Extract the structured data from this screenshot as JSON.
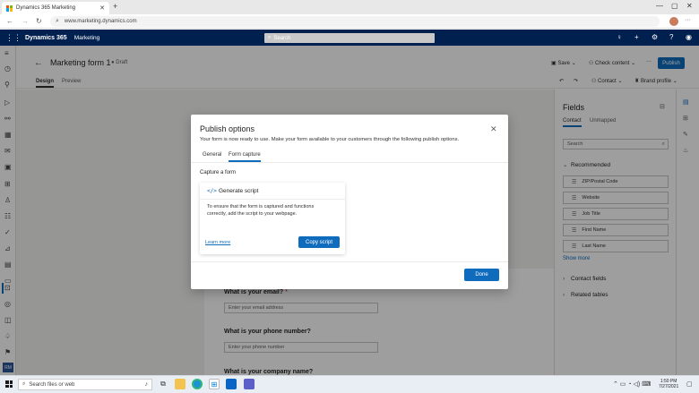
{
  "browser": {
    "tab_title": "Dynamics 365 Marketing",
    "tab_close": "✕",
    "new_tab": "+",
    "url": "www.marketing.dynamics.com",
    "window_controls": [
      "—",
      "▢",
      "✕"
    ],
    "more": "···"
  },
  "appbar": {
    "product": "Dynamics 365",
    "module": "Marketing",
    "search_placeholder": "Search",
    "icons": [
      "lightbulb-icon",
      "plus-icon",
      "gear-icon",
      "help-icon",
      "user-icon"
    ]
  },
  "header": {
    "form_title": "Marketing form 1",
    "status": "Draft",
    "save_label": "Save",
    "check_content_label": "Check content",
    "more_label": "···",
    "publish_label": "Publish",
    "contact_label": "Contact",
    "brand_profile_label": "Brand profile",
    "tabs": [
      {
        "label": "Design"
      },
      {
        "label": "Preview"
      }
    ]
  },
  "form": {
    "questions": [
      {
        "label": "What is your email?",
        "required": "*",
        "placeholder": "Enter your email address"
      },
      {
        "label": "What is your phone number?",
        "required": "",
        "placeholder": "Enter your phone number"
      },
      {
        "label": "What is your company name?",
        "required": "",
        "placeholder": ""
      }
    ]
  },
  "fields_pane": {
    "title": "Fields",
    "tabs": [
      "Contact",
      "Unmapped"
    ],
    "search_placeholder": "Search",
    "recommended_label": "Recommended",
    "items": [
      "ZIP/Postal Code",
      "Website",
      "Job Title",
      "First Name",
      "Last Name"
    ],
    "show_more": "Show more",
    "contact_fields_label": "Contact fields",
    "related_tables_label": "Related tables"
  },
  "dialog": {
    "title": "Publish options",
    "description": "Your form is now ready to use. Make your form available to your customers through the following publish options.",
    "tabs": [
      "General",
      "Form capture"
    ],
    "capture_label": "Capture a form",
    "card_icon": "</>",
    "card_title": "Generate script",
    "card_description": "To ensure that the form is captured and functions correctly, add the script to your webpage.",
    "learn_more": "Learn more",
    "copy_script": "Copy script",
    "done": "Done"
  },
  "taskbar": {
    "search_placeholder": "Search files or web",
    "time": "1:50 PM",
    "date": "7/27/2021"
  },
  "colors": {
    "accent": "#0f6cbd",
    "appbar": "#002050"
  }
}
